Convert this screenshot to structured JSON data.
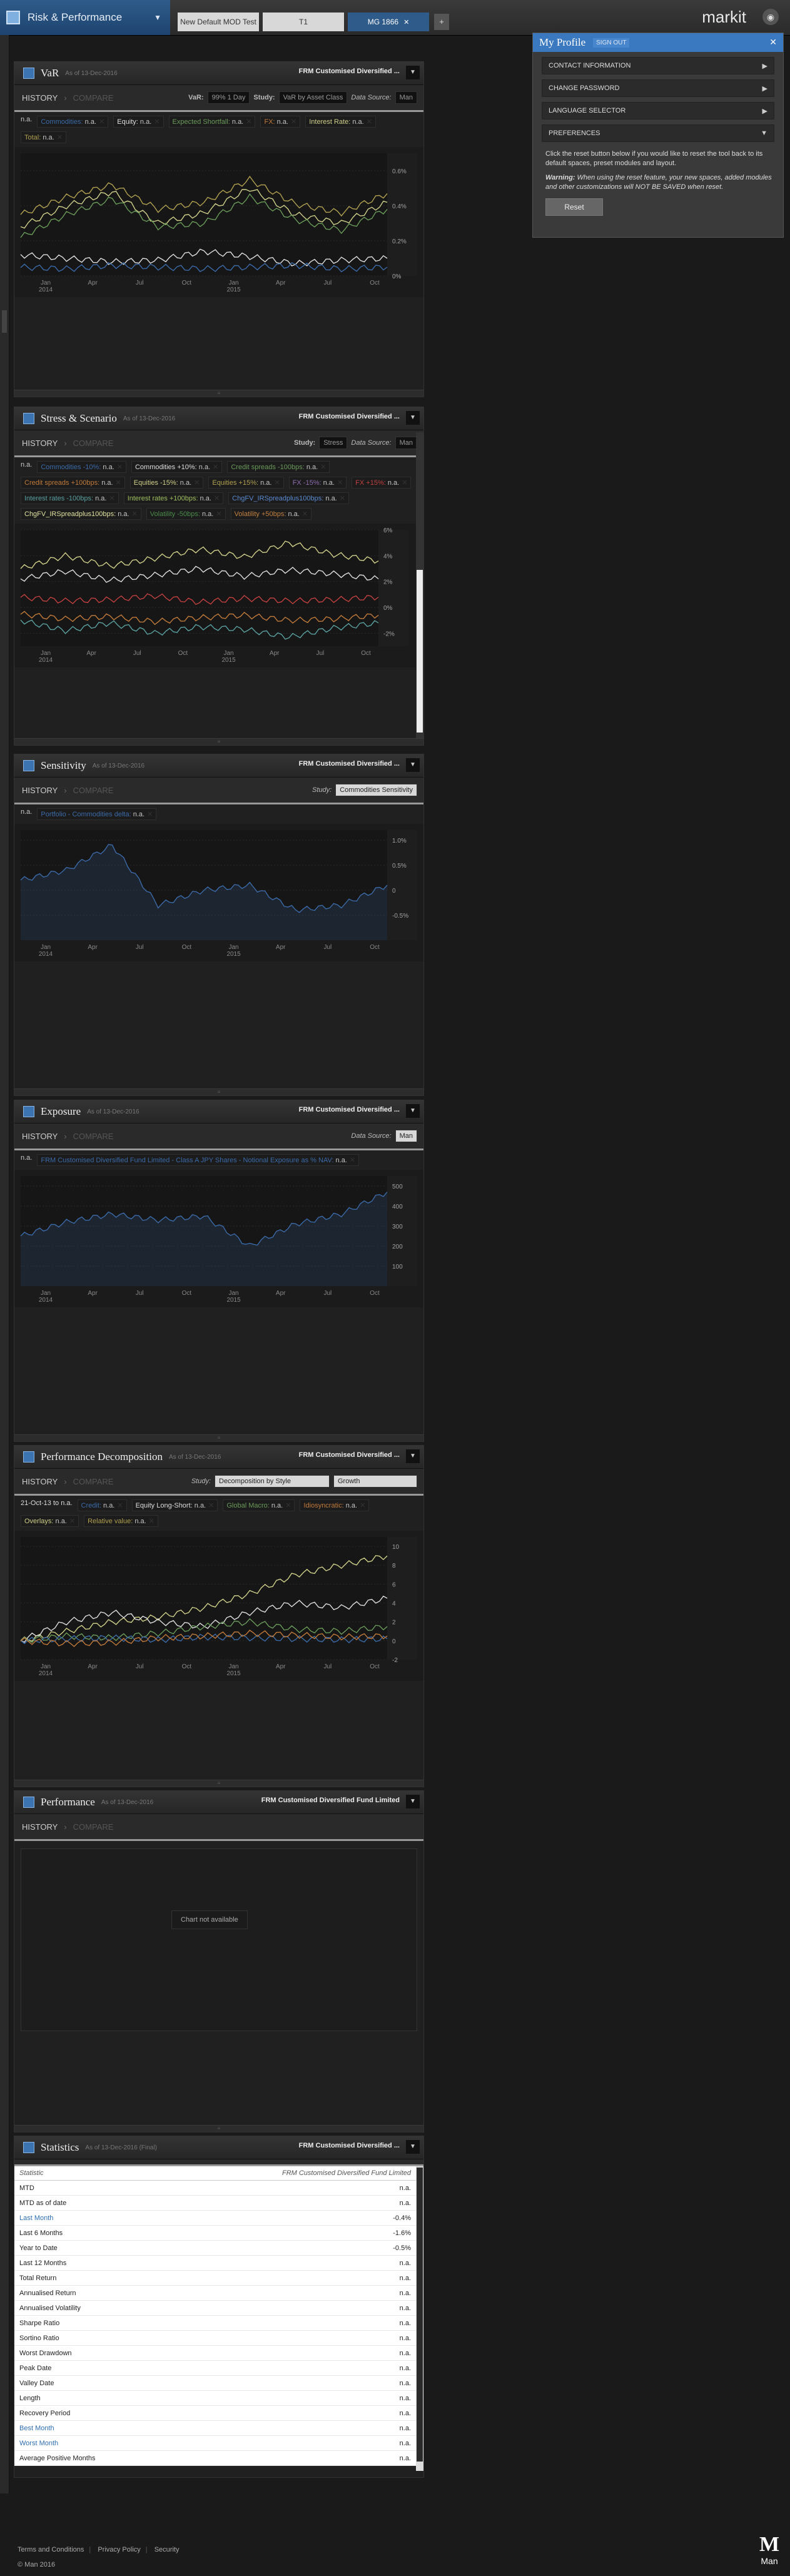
{
  "app": {
    "title": "Risk & Performance"
  },
  "tabs": [
    {
      "label": "New Default MOD Test"
    },
    {
      "label": "T1"
    },
    {
      "label": "MG 1866"
    }
  ],
  "header": {
    "logo": "markit"
  },
  "profile": {
    "title": "My Profile",
    "sign_out": "SIGN OUT",
    "items": [
      "CONTACT INFORMATION",
      "CHANGE PASSWORD",
      "LANGUAGE SELECTOR",
      "PREFERENCES"
    ],
    "text": "Click the reset button below if you would like to reset the tool back to its default spaces, preset modules and layout.",
    "warning_label": "Warning:",
    "warning": "When using the reset feature, your new spaces, added modules and other customizations will NOT BE SAVED when reset.",
    "reset": "Reset"
  },
  "var": {
    "title": "VaR",
    "asof": "As of 13-Dec-2016",
    "fund": "FRM Customised Diversified ...",
    "history": "HISTORY",
    "compare": "COMPARE",
    "var_label": "VaR:",
    "var_value": "99% 1 Day",
    "study_label": "Study:",
    "study_value": "VaR by Asset Class",
    "ds_label": "Data Source:",
    "ds_value": "Man",
    "na": "n.a.",
    "legend": [
      {
        "label": "Commodities",
        "value": "n.a.",
        "color": "#3b6aa8"
      },
      {
        "label": "Equity",
        "value": "n.a.",
        "color": "#dddddd"
      },
      {
        "label": "Expected Shortfall",
        "value": "n.a.",
        "color": "#6a9a5a"
      },
      {
        "label": "FX",
        "value": "n.a.",
        "color": "#c07a3a"
      },
      {
        "label": "Interest Rate",
        "value": "n.a.",
        "color": "#cfcf8a"
      },
      {
        "label": "Total",
        "value": "n.a.",
        "color": "#b0a050"
      }
    ],
    "y_ticks": [
      "0.6%",
      "0.4%",
      "0.2%",
      "0%"
    ],
    "x_ticks": [
      "Jan\n2014",
      "Apr",
      "Jul",
      "Oct",
      "Jan\n2015",
      "Apr",
      "Jul",
      "Oct"
    ]
  },
  "stress": {
    "title": "Stress & Scenario",
    "asof": "As of 13-Dec-2016",
    "fund": "FRM Customised Diversified ...",
    "history": "HISTORY",
    "compare": "COMPARE",
    "study_label": "Study:",
    "study_value": "Stress",
    "ds_label": "Data Source:",
    "ds_value": "Man",
    "na": "n.a.",
    "legend": [
      {
        "label": "Commodities -10%",
        "value": "n.a.",
        "color": "#3b6aa8"
      },
      {
        "label": "Commodities +10%",
        "value": "n.a.",
        "color": "#dddddd"
      },
      {
        "label": "Credit spreads -100bps",
        "value": "n.a.",
        "color": "#6a9a5a"
      },
      {
        "label": "Credit spreads +100bps",
        "value": "n.a.",
        "color": "#c07a3a"
      },
      {
        "label": "Equities -15%",
        "value": "n.a.",
        "color": "#cfcf8a"
      },
      {
        "label": "Equities +15%",
        "value": "n.a.",
        "color": "#b0a050"
      },
      {
        "label": "FX -15%",
        "value": "n.a.",
        "color": "#8e6db0"
      },
      {
        "label": "FX +15%",
        "value": "n.a.",
        "color": "#c04040"
      },
      {
        "label": "Interest rates -100bps",
        "value": "n.a.",
        "color": "#5aa0a0"
      },
      {
        "label": "Interest rates +100bps",
        "value": "n.a.",
        "color": "#a0c060"
      },
      {
        "label": "ChgFV_IRSpreadplus100bps",
        "value": "n.a.",
        "color": "#5a8ad0"
      },
      {
        "label": "ChgFV_IRSpreadplus100bps",
        "value": "n.a.",
        "color": "#e0e0a0"
      },
      {
        "label": "Volatility -50bps",
        "value": "n.a.",
        "color": "#4a8a4a"
      },
      {
        "label": "Volatility +50bps",
        "value": "n.a.",
        "color": "#c08040"
      }
    ],
    "y_ticks": [
      "6%",
      "4%",
      "2%",
      "0%",
      "-2%"
    ],
    "x_ticks": [
      "Jan\n2014",
      "Apr",
      "Jul",
      "Oct",
      "Jan\n2015",
      "Apr",
      "Jul",
      "Oct"
    ]
  },
  "sensitivity": {
    "title": "Sensitivity",
    "asof": "As of 13-Dec-2016",
    "fund": "FRM Customised Diversified ...",
    "history": "HISTORY",
    "compare": "COMPARE",
    "study_label": "Study:",
    "study_value": "Commodities Sensitivity",
    "na": "n.a.",
    "legend": [
      {
        "label": "Portfolio - Commodities delta",
        "value": "n.a.",
        "color": "#3b6aa8"
      }
    ],
    "y_ticks": [
      "1.0%",
      "0.5%",
      "0",
      "-0.5%"
    ],
    "x_ticks": [
      "Jan\n2014",
      "Apr",
      "Jul",
      "Oct",
      "Jan\n2015",
      "Apr",
      "Jul",
      "Oct"
    ]
  },
  "exposure": {
    "title": "Exposure",
    "asof": "As of 13-Dec-2016",
    "fund": "FRM Customised Diversified ...",
    "history": "HISTORY",
    "compare": "COMPARE",
    "ds_label": "Data Source:",
    "ds_value": "Man",
    "na": "n.a.",
    "legend": [
      {
        "label": "FRM Customised Diversified Fund Limited - Class A JPY Shares - Notional Exposure as % NAV",
        "value": "n.a.",
        "color": "#3b6aa8"
      }
    ],
    "y_ticks": [
      "500",
      "400",
      "300",
      "200",
      "100"
    ],
    "x_ticks": [
      "Jan\n2014",
      "Apr",
      "Jul",
      "Oct",
      "Jan\n2015",
      "Apr",
      "Jul",
      "Oct"
    ]
  },
  "perfdec": {
    "title": "Performance Decomposition",
    "asof": "As of 13-Dec-2016",
    "fund": "FRM Customised Diversified ...",
    "history": "HISTORY",
    "compare": "COMPARE",
    "study_label": "Study:",
    "study_value": "Decomposition by Style",
    "growth_value": "Growth",
    "date_label": "21-Oct-13 to n.a.",
    "legend": [
      {
        "label": "Credit",
        "value": "n.a.",
        "color": "#3b6aa8"
      },
      {
        "label": "Equity Long-Short",
        "value": "n.a.",
        "color": "#dddddd"
      },
      {
        "label": "Global Macro",
        "value": "n.a.",
        "color": "#6a9a5a"
      },
      {
        "label": "Idiosyncratic",
        "value": "n.a.",
        "color": "#c07a3a"
      },
      {
        "label": "Overlays",
        "value": "n.a.",
        "color": "#cfcf8a"
      },
      {
        "label": "Relative value",
        "value": "n.a.",
        "color": "#b0a050"
      }
    ],
    "y_ticks": [
      "10",
      "8",
      "6",
      "4",
      "2",
      "0",
      "-2"
    ],
    "x_ticks": [
      "Jan\n2014",
      "Apr",
      "Jul",
      "Oct",
      "Jan\n2015",
      "Apr",
      "Jul",
      "Oct"
    ]
  },
  "performance": {
    "title": "Performance",
    "asof": "As of 13-Dec-2016",
    "fund": "FRM Customised Diversified Fund Limited",
    "history": "HISTORY",
    "compare": "COMPARE",
    "not_available": "Chart not available"
  },
  "statistics": {
    "title": "Statistics",
    "asof": "As of 13-Dec-2016 (Final)",
    "fund": "FRM Customised Diversified ...",
    "col_stat": "Statistic",
    "col_fund": "FRM Customised Diversified Fund Limited",
    "rows": [
      {
        "label": "MTD",
        "value": "n.a.",
        "link": false
      },
      {
        "label": "MTD as of date",
        "value": "n.a.",
        "link": false
      },
      {
        "label": "Last Month",
        "value": "-0.4%",
        "link": true
      },
      {
        "label": "Last 6 Months",
        "value": "-1.6%",
        "link": false
      },
      {
        "label": "Year to Date",
        "value": "-0.5%",
        "link": false
      },
      {
        "label": "Last 12 Months",
        "value": "n.a.",
        "link": false
      },
      {
        "label": "Total Return",
        "value": "n.a.",
        "link": false
      },
      {
        "label": "Annualised Return",
        "value": "n.a.",
        "link": false
      },
      {
        "label": "Annualised Volatility",
        "value": "n.a.",
        "link": false
      },
      {
        "label": "Sharpe Ratio",
        "value": "n.a.",
        "link": false
      },
      {
        "label": "Sortino Ratio",
        "value": "n.a.",
        "link": false
      },
      {
        "label": "Worst Drawdown",
        "value": "n.a.",
        "link": false
      },
      {
        "label": "Peak Date",
        "value": "n.a.",
        "link": false
      },
      {
        "label": "Valley Date",
        "value": "n.a.",
        "link": false
      },
      {
        "label": "Length",
        "value": "n.a.",
        "link": false
      },
      {
        "label": "Recovery Period",
        "value": "n.a.",
        "link": false
      },
      {
        "label": "Best Month",
        "value": "n.a.",
        "link": true
      },
      {
        "label": "Worst Month",
        "value": "n.a.",
        "link": true
      },
      {
        "label": "Average Positive Months",
        "value": "n.a.",
        "link": false
      }
    ]
  },
  "footer": {
    "terms": "Terms and Conditions",
    "privacy": "Privacy Policy",
    "security": "Security",
    "copyright": "© Man 2016",
    "logo_m": "M",
    "logo_text": "Man"
  },
  "chart_data": [
    {
      "type": "line",
      "title": "VaR",
      "x": [
        "2013-10",
        "2014-01",
        "2014-04",
        "2014-07",
        "2014-10",
        "2015-01",
        "2015-04",
        "2015-07",
        "2015-10"
      ],
      "ylim": [
        0,
        0.7
      ],
      "series": [
        {
          "name": "Total",
          "values": [
            0.35,
            0.45,
            0.52,
            0.38,
            0.42,
            0.55,
            0.41,
            0.36,
            0.47
          ]
        },
        {
          "name": "Interest Rate",
          "values": [
            0.28,
            0.4,
            0.48,
            0.3,
            0.36,
            0.5,
            0.35,
            0.3,
            0.42
          ]
        },
        {
          "name": "Expected Shortfall",
          "values": [
            0.22,
            0.35,
            0.44,
            0.28,
            0.3,
            0.45,
            0.32,
            0.26,
            0.38
          ]
        },
        {
          "name": "Equity",
          "values": [
            0.12,
            0.1,
            0.08,
            0.09,
            0.14,
            0.11,
            0.07,
            0.09,
            0.1
          ]
        },
        {
          "name": "Commodities",
          "values": [
            0.05,
            0.04,
            0.06,
            0.05,
            0.04,
            0.05,
            0.06,
            0.04,
            0.05
          ]
        }
      ]
    },
    {
      "type": "line",
      "title": "Stress & Scenario",
      "x": [
        "2013-10",
        "2014-01",
        "2014-04",
        "2014-07",
        "2014-10",
        "2015-01",
        "2015-04",
        "2015-07",
        "2015-10"
      ],
      "ylim": [
        -3,
        6
      ],
      "series": [
        {
          "name": "Equities +15%",
          "values": [
            3.0,
            4.0,
            3.2,
            3.8,
            4.5,
            3.9,
            5.0,
            4.1,
            3.6
          ]
        },
        {
          "name": "Commodities +10%",
          "values": [
            2.2,
            2.8,
            2.1,
            2.5,
            3.0,
            2.4,
            2.9,
            2.6,
            2.2
          ]
        },
        {
          "name": "FX +15%",
          "values": [
            0.8,
            0.5,
            0.6,
            0.9,
            0.4,
            0.7,
            0.5,
            0.6,
            0.8
          ]
        },
        {
          "name": "Equities -15%",
          "values": [
            -1.0,
            -1.8,
            -1.2,
            -2.0,
            -1.5,
            -1.7,
            -2.3,
            -1.6,
            -1.2
          ]
        },
        {
          "name": "Credit spreads +100bps",
          "values": [
            -0.5,
            -0.9,
            -0.7,
            -1.1,
            -0.8,
            -0.6,
            -1.0,
            -0.9,
            -0.6
          ]
        }
      ]
    },
    {
      "type": "area",
      "title": "Sensitivity",
      "x": [
        "2013-10",
        "2014-01",
        "2014-04",
        "2014-07",
        "2014-10",
        "2015-01",
        "2015-04",
        "2015-07",
        "2015-10"
      ],
      "ylim": [
        -1.0,
        1.2
      ],
      "series": [
        {
          "name": "Portfolio - Commodities delta",
          "values": [
            0.2,
            0.4,
            0.9,
            -0.3,
            0.0,
            0.1,
            -0.4,
            -0.3,
            0.1
          ]
        }
      ]
    },
    {
      "type": "area",
      "title": "Exposure",
      "x": [
        "2013-10",
        "2014-01",
        "2014-04",
        "2014-07",
        "2014-10",
        "2015-01",
        "2015-04",
        "2015-07",
        "2015-10"
      ],
      "ylim": [
        0,
        550
      ],
      "series": [
        {
          "name": "FRM Customised Diversified Fund Limited - Class A JPY Shares - Notional Exposure as % NAV",
          "values": [
            250,
            320,
            360,
            330,
            350,
            200,
            310,
            360,
            470
          ]
        }
      ]
    },
    {
      "type": "line",
      "title": "Performance Decomposition",
      "x": [
        "2013-10",
        "2014-01",
        "2014-04",
        "2014-07",
        "2014-10",
        "2015-01",
        "2015-04",
        "2015-07",
        "2015-10"
      ],
      "ylim": [
        -2,
        11
      ],
      "series": [
        {
          "name": "Equity Long-Short",
          "values": [
            0,
            1.0,
            2.0,
            2.5,
            3.5,
            5.0,
            7.0,
            8.0,
            9.0
          ]
        },
        {
          "name": "Overlays",
          "values": [
            0,
            2.0,
            3.0,
            2.0,
            1.5,
            3.0,
            4.0,
            3.5,
            4.5
          ]
        },
        {
          "name": "Global Macro",
          "values": [
            0,
            0.5,
            0.3,
            0.8,
            1.5,
            2.0,
            1.2,
            1.0,
            1.5
          ]
        },
        {
          "name": "Credit",
          "values": [
            0,
            0.2,
            0.3,
            0.1,
            0.4,
            0.3,
            0.2,
            0.1,
            0.2
          ]
        },
        {
          "name": "Idiosyncratic",
          "values": [
            0,
            -0.3,
            -0.2,
            0.3,
            0.5,
            0.8,
            0.6,
            0.4,
            0.5
          ]
        }
      ]
    }
  ]
}
